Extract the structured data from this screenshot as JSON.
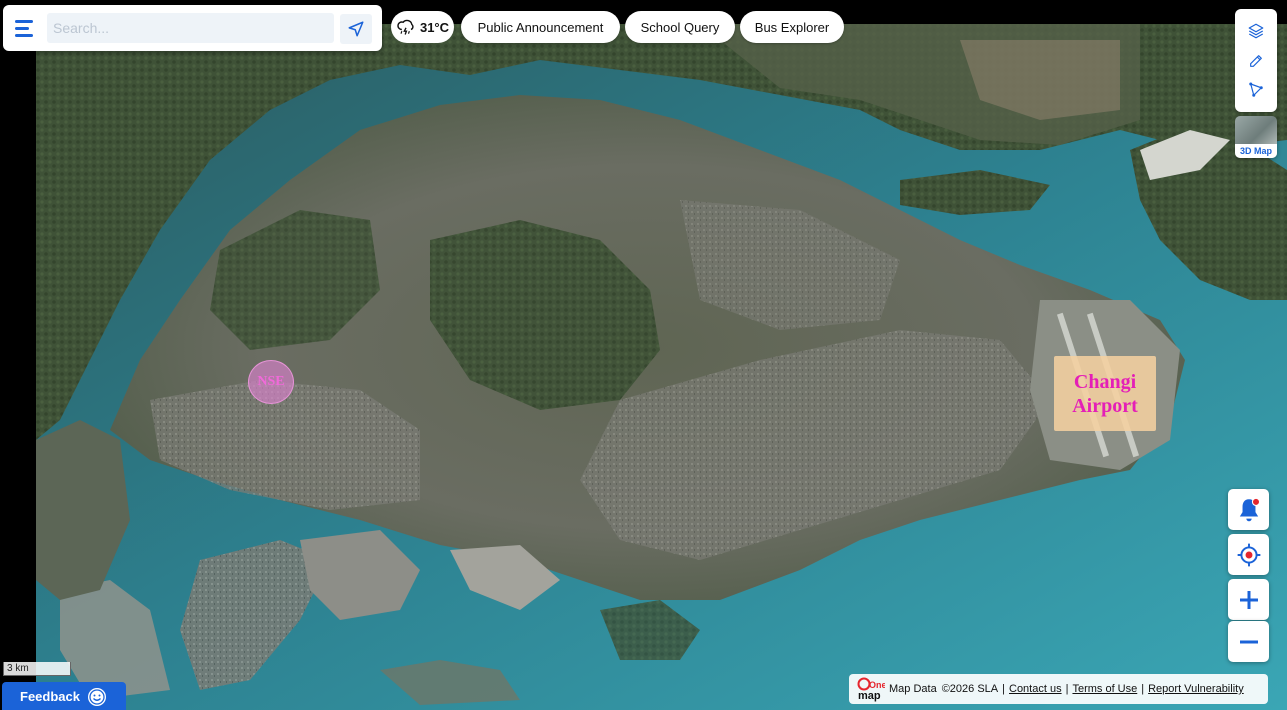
{
  "search": {
    "placeholder": "Search..."
  },
  "weather": {
    "temperature": "31°C",
    "icon": "thunderstorm-icon"
  },
  "top_nav": [
    "Public Announcement",
    "School Query",
    "Bus Explorer"
  ],
  "toolbar": {
    "tools": [
      "layers-icon",
      "draw-icon",
      "measure-icon"
    ],
    "map3d_label": "3D Map"
  },
  "map_labels": {
    "changi_line1": "Changi",
    "changi_line2": "Airport",
    "nse": "NSE"
  },
  "scale": {
    "label": "3 km"
  },
  "feedback": {
    "label": "Feedback"
  },
  "attribution": {
    "logo_top": "One",
    "logo_bottom": "map",
    "map_data": "Map Data",
    "copyright": "©2026 SLA",
    "links": [
      "Contact us",
      "Terms of Use",
      "Report Vulnerability"
    ]
  },
  "colors": {
    "accent": "#1b63d8",
    "label_magenta": "#e41fb7",
    "sea": "#2f8fa0",
    "land": "#5b6a52"
  }
}
